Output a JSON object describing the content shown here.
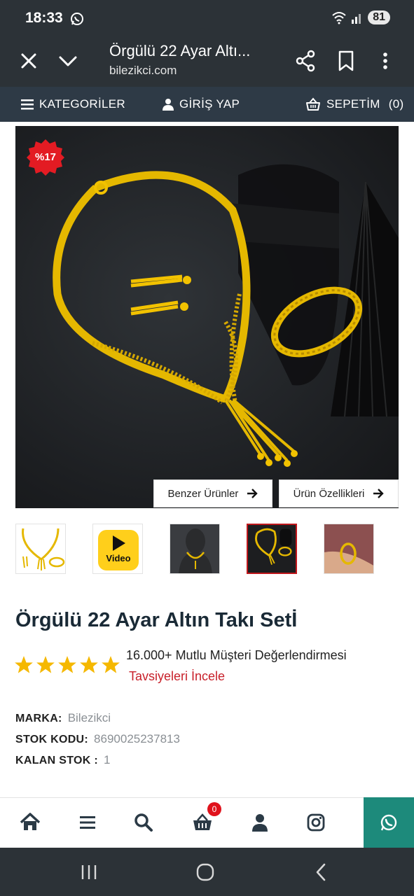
{
  "status_bar": {
    "time": "18:33",
    "battery": "81",
    "icons": [
      "whatsapp-icon",
      "wifi-icon",
      "signal-icon"
    ]
  },
  "browser": {
    "title": "Örgülü 22 Ayar Altı...",
    "domain": "bilezikci.com"
  },
  "site_nav": {
    "categories": "KATEGORİLER",
    "login": "GİRİŞ YAP",
    "cart": "SEPETİM",
    "cart_count": "(0)"
  },
  "product": {
    "discount": "%17",
    "similar_btn": "Benzer Ürünler",
    "features_btn": "Ürün Özellikleri",
    "video_label": "Video",
    "title": "Örgülü 22 Ayar Altın Takı Setİ",
    "rating": 5,
    "review_count": "16.000+ Mutlu Müşteri Değerlendirmesi",
    "review_link": "Tavsiyeleri İncele",
    "specs": {
      "brand_label": "MARKA:",
      "brand_value": "Bilezikci",
      "sku_label": "STOK KODU:",
      "sku_value": "8690025237813",
      "stock_label": "KALAN STOK :",
      "stock_value": "1"
    }
  },
  "bottom_bar": {
    "cart_badge": "0",
    "icons": [
      "home-icon",
      "menu-icon",
      "search-icon",
      "basket-icon",
      "user-icon",
      "instagram-icon",
      "whatsapp-icon"
    ]
  },
  "colors": {
    "header_bg": "#2c3237",
    "nav_bg": "#2e3a46",
    "accent_red": "#c8202a",
    "star": "#f5b800",
    "whatsapp": "#1d8a7b",
    "gold": "#f2c200"
  }
}
